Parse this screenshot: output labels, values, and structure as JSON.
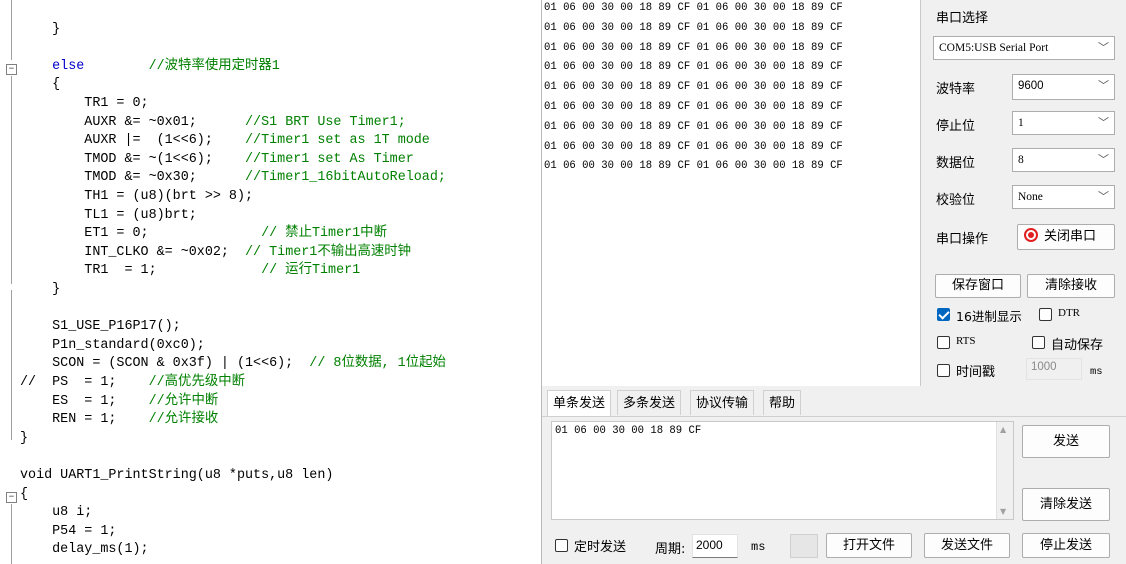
{
  "editor": {
    "lines": [
      {
        "t": "        ",
        "k": "",
        "s": "",
        "c": ""
      },
      {
        "t": "    }",
        "k": "",
        "s": "",
        "c": ""
      },
      {
        "t": "",
        "k": "",
        "s": "",
        "c": ""
      },
      {
        "t": "    else",
        "k": "kw",
        "s": "        ",
        "c": "//波特率使用定时器1"
      },
      {
        "t": "    {",
        "k": "",
        "s": "",
        "c": ""
      },
      {
        "t": "        TR1 = 0;",
        "k": "",
        "s": "",
        "c": ""
      },
      {
        "t": "        AUXR &= ~0x01;",
        "k": "",
        "s": "      ",
        "c": "//S1 BRT Use Timer1;"
      },
      {
        "t": "        AUXR |=  (1<<6);",
        "k": "",
        "s": "    ",
        "c": "//Timer1 set as 1T mode"
      },
      {
        "t": "        TMOD &= ~(1<<6);",
        "k": "",
        "s": "    ",
        "c": "//Timer1 set As Timer"
      },
      {
        "t": "        TMOD &= ~0x30;",
        "k": "",
        "s": "      ",
        "c": "//Timer1_16bitAutoReload;"
      },
      {
        "t": "        TH1 = (u8)(brt >> 8);",
        "k": "",
        "s": "",
        "c": ""
      },
      {
        "t": "        TL1 = (u8)brt;",
        "k": "",
        "s": "",
        "c": ""
      },
      {
        "t": "        ET1 = 0;",
        "k": "",
        "s": "              ",
        "c": "// 禁止Timer1中断"
      },
      {
        "t": "        INT_CLKO &= ~0x02;",
        "k": "",
        "s": "  ",
        "c": "// Timer1不输出高速时钟"
      },
      {
        "t": "        TR1  = 1;",
        "k": "",
        "s": "             ",
        "c": "// 运行Timer1"
      },
      {
        "t": "    }",
        "k": "",
        "s": "",
        "c": ""
      },
      {
        "t": "",
        "k": "",
        "s": "",
        "c": ""
      },
      {
        "t": "    S1_USE_P16P17();",
        "k": "",
        "s": "",
        "c": ""
      },
      {
        "t": "    P1n_standard(0xc0);",
        "k": "",
        "s": "",
        "c": ""
      },
      {
        "t": "    SCON = (SCON & 0x3f) | (1<<6);",
        "k": "",
        "s": "  ",
        "c": "// 8位数据, 1位起始"
      },
      {
        "t": "//  PS  = 1;",
        "k": "",
        "s": "    ",
        "c": "//高优先级中断"
      },
      {
        "t": "    ES  = 1;",
        "k": "",
        "s": "    ",
        "c": "//允许中断"
      },
      {
        "t": "    REN = 1;",
        "k": "",
        "s": "    ",
        "c": "//允许接收"
      },
      {
        "t": "}",
        "k": "",
        "s": "",
        "c": ""
      },
      {
        "t": "",
        "k": "",
        "s": "",
        "c": ""
      },
      {
        "t": "void UART1_PrintString(u8 *puts,u8 len)",
        "k": "",
        "s": "",
        "c": ""
      },
      {
        "t": "{",
        "k": "",
        "s": "",
        "c": ""
      },
      {
        "t": "    u8 i;",
        "k": "",
        "s": "",
        "c": ""
      },
      {
        "t": "    P54 = 1;",
        "k": "",
        "s": "",
        "c": ""
      },
      {
        "t": "    delay_ms(1);",
        "k": "",
        "s": "",
        "c": ""
      }
    ]
  },
  "receive": {
    "lines": [
      "01 06 00 30 00 18 89 CF 01 06 00 30 00 18 89 CF",
      "01 06 00 30 00 18 89 CF 01 06 00 30 00 18 89 CF",
      "01 06 00 30 00 18 89 CF 01 06 00 30 00 18 89 CF",
      "01 06 00 30 00 18 89 CF 01 06 00 30 00 18 89 CF",
      "01 06 00 30 00 18 89 CF 01 06 00 30 00 18 89 CF",
      "01 06 00 30 00 18 89 CF 01 06 00 30 00 18 89 CF",
      "01 06 00 30 00 18 89 CF 01 06 00 30 00 18 89 CF",
      "01 06 00 30 00 18 89 CF 01 06 00 30 00 18 89 CF",
      "01 06 00 30 00 18 89 CF 01 06 00 30 00 18 89 CF"
    ]
  },
  "panel": {
    "port_select_label": "串口选择",
    "port_value": "COM5:USB Serial Port",
    "baud_label": "波特率",
    "baud_value": "9600",
    "stopbits_label": "停止位",
    "stopbits_value": "1",
    "databits_label": "数据位",
    "databits_value": "8",
    "parity_label": "校验位",
    "parity_value": "None",
    "port_op_label": "串口操作",
    "close_port_button": "关闭串口",
    "save_window_button": "保存窗口",
    "clear_receive_button": "清除接收",
    "hex_display_label": "16进制显示",
    "hex_display_checked": true,
    "dtr_label": "DTR",
    "rts_label": "RTS",
    "auto_save_label": "自动保存",
    "timestamp_label": "时间戳",
    "timestamp_value": "1000",
    "timestamp_unit": "ms"
  },
  "tabs": [
    "单条发送",
    "多条发送",
    "协议传输",
    "帮助"
  ],
  "send": {
    "text": "01 06 00 30 00 18 89 CF",
    "send_button": "发送",
    "clear_send_button": "清除发送",
    "timed_send_label": "定时发送",
    "period_label": "周期:",
    "period_value": "2000",
    "period_unit": "ms",
    "open_file_button": "打开文件",
    "send_file_button": "发送文件",
    "stop_send_button": "停止发送"
  },
  "colors": {
    "keyword": "#0000c8",
    "comment": "#008000",
    "accent": "#0067c0",
    "close_port_icon": "#e02020"
  }
}
